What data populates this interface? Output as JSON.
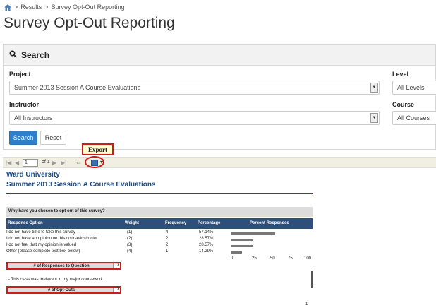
{
  "breadcrumb": {
    "home_icon": "home-icon",
    "items": [
      "Results",
      "Survey Opt-Out Reporting"
    ],
    "separator": ">"
  },
  "page_title": "Survey Opt-Out Reporting",
  "search": {
    "heading": "Search",
    "icon": "search-icon",
    "project": {
      "label": "Project",
      "value": "Summer 2013 Session A Course Evaluations"
    },
    "level": {
      "label": "Level",
      "value": "All Levels"
    },
    "instructor": {
      "label": "Instructor",
      "value": "All Instructors"
    },
    "course": {
      "label": "Course",
      "value": "All Courses"
    },
    "search_button": "Search",
    "reset_button": "Reset"
  },
  "toolbar": {
    "page_value": "1",
    "page_of": "of 1",
    "export_icon": "save-disk-icon",
    "export_callout": "Export"
  },
  "report": {
    "organization": "Ward University",
    "project_name": "Summer 2013 Session A Course Evaluations",
    "question": "Why have you chosen to opt out of this survey?",
    "columns": [
      "Response Option",
      "Weight",
      "Frequency",
      "Percentage",
      "Percent Responses"
    ],
    "rows": [
      {
        "option": "I do not have time to take this survey",
        "weight": "(1)",
        "frequency": "4",
        "percentage": "57.14%",
        "percent": 57.14
      },
      {
        "option": "I do not have an opinion on this course/instructor",
        "weight": "(2)",
        "frequency": "2",
        "percentage": "28.57%",
        "percent": 28.57
      },
      {
        "option": "I do not feel that my opinion is valued",
        "weight": "(3)",
        "frequency": "2",
        "percentage": "28.57%",
        "percent": 28.57
      },
      {
        "option": "Other (please complete text box below)",
        "weight": "(4)",
        "frequency": "1",
        "percentage": "14.29%",
        "percent": 14.29
      }
    ],
    "axis_ticks": [
      "0",
      "25",
      "50",
      "75",
      "100"
    ],
    "responses_label": "# of Responses to Question",
    "responses_value": "7",
    "comment": "- This class was irrelevant in my major coursework",
    "optouts_label": "# of Opt-Outs",
    "optouts_value": "7",
    "page_number": "1"
  },
  "colors": {
    "accent_blue": "#2f7fc8",
    "report_title_blue": "#1f4e8c",
    "table_header": "#2e4f79",
    "highlight_red": "#d11a1a",
    "callout_yellow": "#fffccc"
  }
}
